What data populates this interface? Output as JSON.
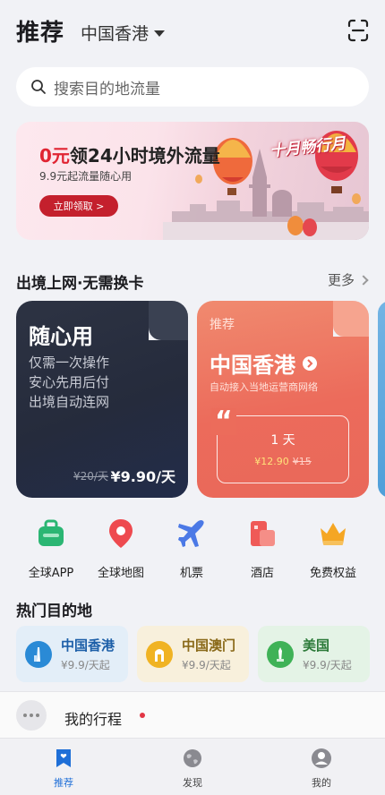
{
  "header": {
    "title": "推荐",
    "region": "中国香港"
  },
  "search": {
    "placeholder": "搜索目的地流量"
  },
  "banner": {
    "title_red": "0元",
    "title_rest": "领24小时境外流量",
    "subtitle": "9.9元起流量随心用",
    "button": "立即领取 >",
    "badge": "十月畅行月"
  },
  "section": {
    "title": "出境上网·无需换卡",
    "more": "更多"
  },
  "card_any": {
    "title": "随心用",
    "lines": [
      "仅需一次操作",
      "安心先用后付",
      "出境自动连网"
    ],
    "old_price": "¥20/天",
    "price": "¥9.90/天"
  },
  "card_rec": {
    "tag": "推荐",
    "title": "中国香港",
    "subtitle": "自动接入当地运营商网络",
    "quote": "“",
    "day": "1 天",
    "price_now": "¥12.90",
    "price_was": "¥15"
  },
  "quick_nav": [
    {
      "label": "全球APP",
      "icon": "suitcase-icon",
      "color": "#2bb673"
    },
    {
      "label": "全球地图",
      "icon": "map-pin-icon",
      "color": "#ee4a4f"
    },
    {
      "label": "机票",
      "icon": "airplane-icon",
      "color": "#4b79e6"
    },
    {
      "label": "酒店",
      "icon": "hotel-icon",
      "color": "#ef5a57"
    },
    {
      "label": "免费权益",
      "icon": "crown-icon",
      "color": "#f5a623"
    }
  ],
  "hot": {
    "title": "热门目的地",
    "items": [
      {
        "name": "中国香港",
        "price": "¥9.9/天起",
        "bg": "#e3eef8",
        "text": "#1d5fa8",
        "circle": "#2a8ad6"
      },
      {
        "name": "中国澳门",
        "price": "¥9.9/天起",
        "bg": "#f8f0dc",
        "text": "#8a6a1a",
        "circle": "#f0b323"
      },
      {
        "name": "美国",
        "price": "¥9.9/天起",
        "bg": "#e4f3e6",
        "text": "#2c7a39",
        "circle": "#3fb257"
      }
    ]
  },
  "trip": {
    "label": "我的行程"
  },
  "tabs": [
    {
      "label": "推荐",
      "active": true
    },
    {
      "label": "发现",
      "active": false
    },
    {
      "label": "我的",
      "active": false
    }
  ],
  "colors": {
    "accent": "#1f6fd7",
    "banner_button": "#c4202d",
    "rec_card": "#ec6b5b",
    "dark_card": "#262c3d"
  }
}
